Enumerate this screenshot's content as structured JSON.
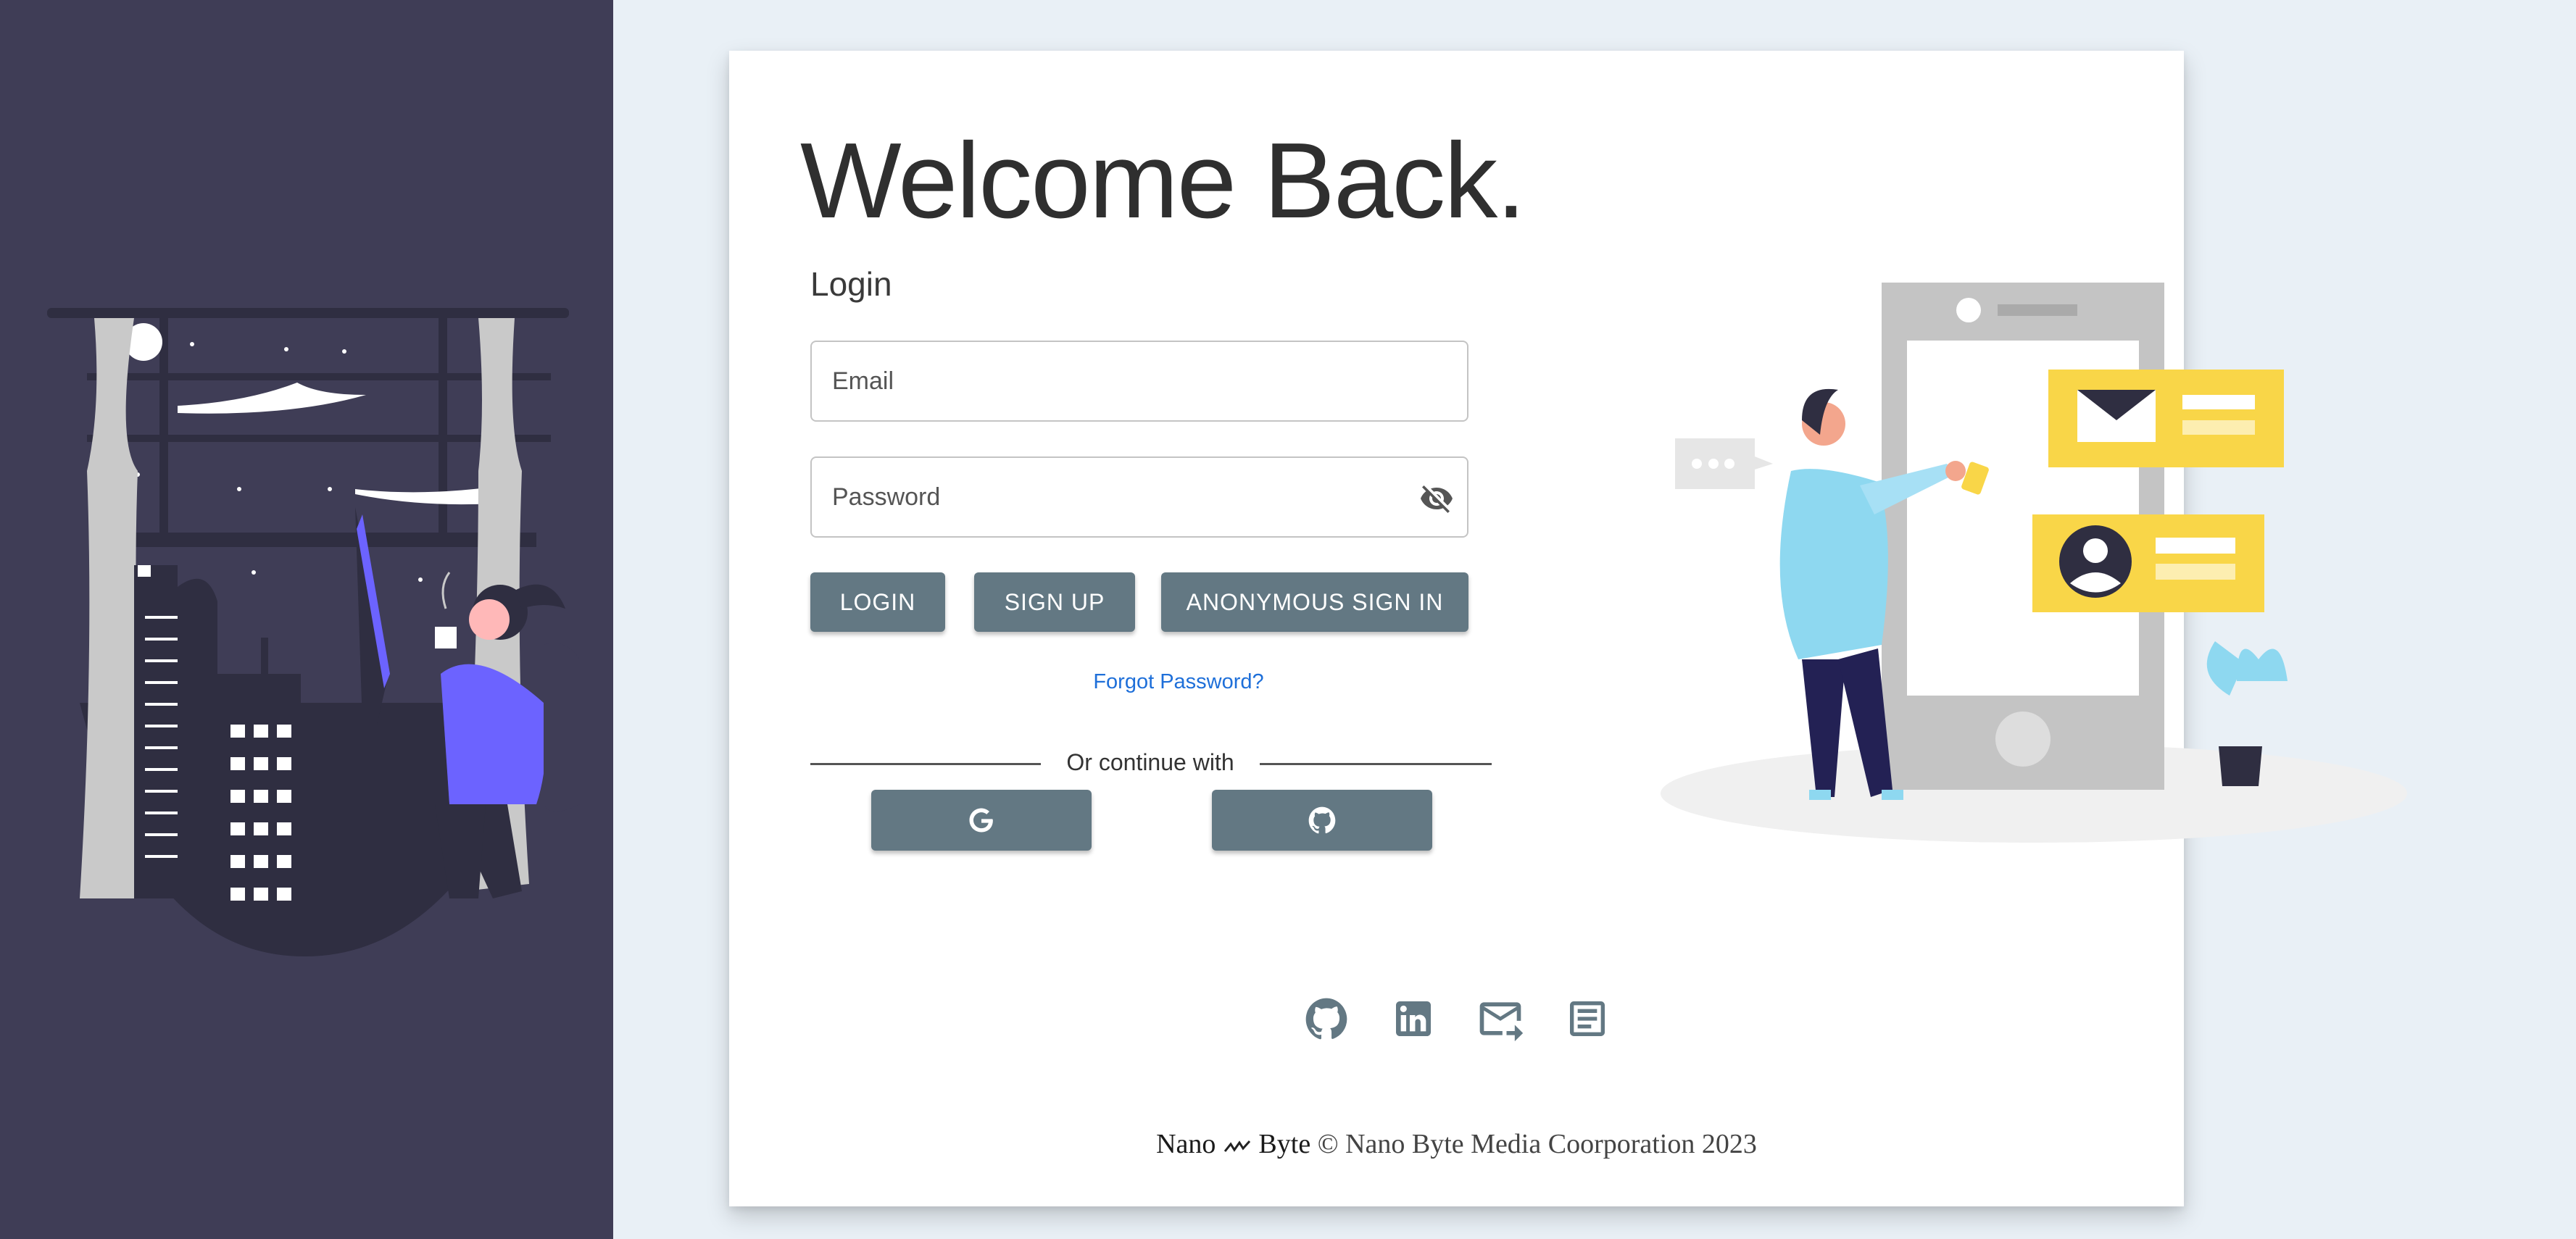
{
  "login": {
    "heading": "Welcome Back.",
    "subheading": "Login",
    "email_placeholder": "Email",
    "password_placeholder": "Password",
    "login_label": "LOGIN",
    "signup_label": "SIGN UP",
    "anonymous_label": "ANONYMOUS SIGN IN",
    "forgot_label": "Forgot Password?",
    "divider_label": "Or continue with",
    "social": [
      {
        "icon": "google-icon"
      },
      {
        "icon": "github-icon"
      }
    ]
  },
  "footer": {
    "links": [
      {
        "icon": "github-icon"
      },
      {
        "icon": "linkedin-icon"
      },
      {
        "icon": "mail-forward-icon"
      },
      {
        "icon": "article-icon"
      }
    ],
    "brand_left": "Nano",
    "brand_right": "Byte",
    "copyright": "© Nano Byte Media Coorporation 2023"
  },
  "colors": {
    "left_panel": "#3f3d56",
    "background": "#e9f0f6",
    "button": "#637883",
    "link": "#1e6fd9",
    "accent_yellow": "#f9d648",
    "accent_blue": "#8ed8f0"
  }
}
